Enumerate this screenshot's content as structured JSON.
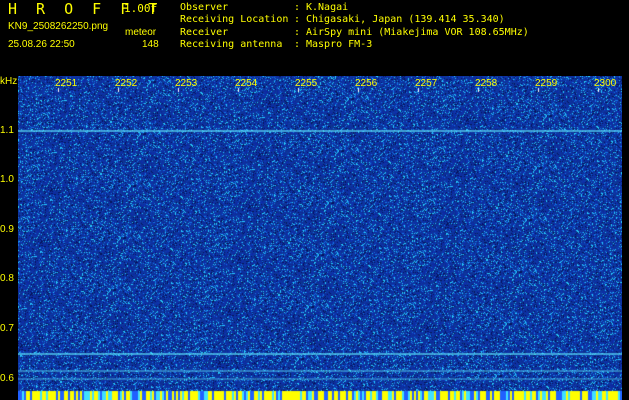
{
  "header": {
    "app_title": "H R O F F T",
    "version": "1.00f",
    "file_name": "KN9_2508262250.png",
    "timestamp": "25.08.26 22:50",
    "mode_label": "meteor",
    "count": "148"
  },
  "info": {
    "rows": [
      {
        "key": "Observer",
        "value": "K.Nagai"
      },
      {
        "key": "Receiving Location",
        "value": "Chigasaki, Japan (139.414 35.340)"
      },
      {
        "key": "Receiver",
        "value": "AirSpy mini (Miakejima VOR 108.65MHz)"
      },
      {
        "key": "Receiving antenna",
        "value": "Maspro FM-3"
      }
    ]
  },
  "axis": {
    "y_unit": "kHz",
    "y_ticks": [
      "1.1",
      "1.0",
      "0.9",
      "0.8",
      "0.7",
      "0.6"
    ],
    "x_ticks": [
      "2251",
      "2252",
      "2253",
      "2254",
      "2255",
      "2256",
      "2257",
      "2258",
      "2259",
      "2300"
    ]
  },
  "colors": {
    "background": "#000000",
    "text": "#ffff00",
    "spectrogram_base": "#0d2f9a",
    "noise_bright": "#2ad6ff",
    "line": "#5fe8ff",
    "bottom_band": "#ffff00"
  }
}
